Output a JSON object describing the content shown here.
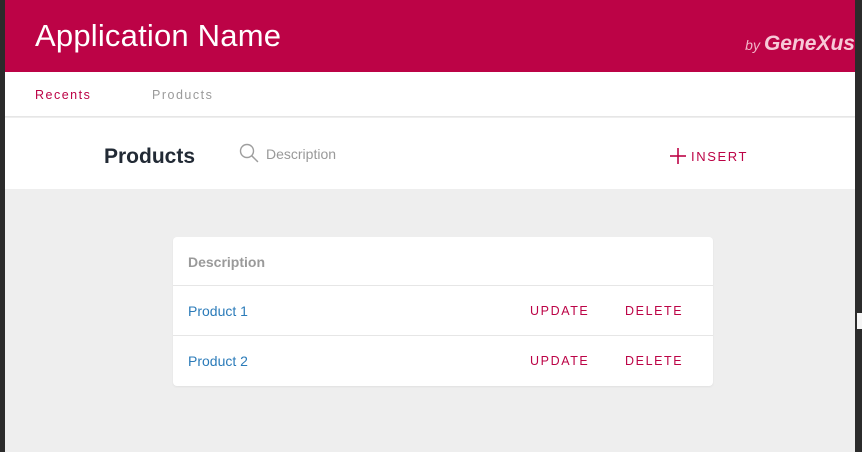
{
  "header": {
    "app_title": "Application Name",
    "brand_by": "by",
    "brand_name": "GeneXus",
    "background_color": "#bc0346"
  },
  "tabs": [
    {
      "label": "Recents",
      "active": true
    },
    {
      "label": "Products",
      "active": false
    }
  ],
  "toolbar": {
    "title": "Products",
    "search": {
      "placeholder": "Description",
      "value": "",
      "icon": "search-icon"
    },
    "insert": {
      "label": "INSERT",
      "icon": "plus-icon"
    }
  },
  "grid": {
    "columns": [
      "Description"
    ],
    "rows": [
      {
        "description": "Product 1",
        "update_label": "UPDATE",
        "delete_label": "DELETE"
      },
      {
        "description": "Product 2",
        "update_label": "UPDATE",
        "delete_label": "DELETE"
      }
    ]
  },
  "colors": {
    "accent": "#bc0346",
    "link": "#2b7bb9",
    "content_background": "#eeeeee"
  }
}
